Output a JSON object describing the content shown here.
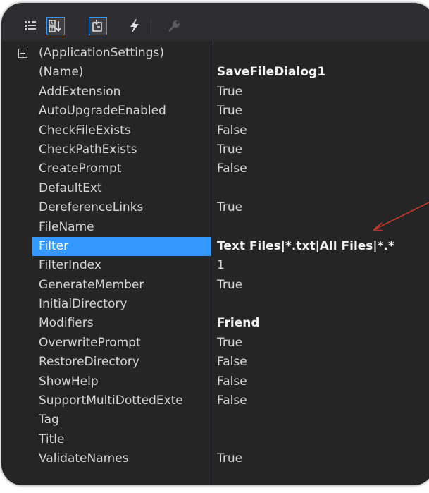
{
  "toolbar": {
    "buttons": [
      {
        "icon": "categorized-icon",
        "active": false
      },
      {
        "icon": "alphabetical-icon",
        "active": true
      },
      {
        "icon": "properties-icon",
        "active": true
      },
      {
        "icon": "events-icon",
        "active": false
      },
      {
        "icon": "property-pages-icon",
        "active": false
      }
    ]
  },
  "properties": [
    {
      "name": "(ApplicationSettings)",
      "value": "",
      "expandable": true
    },
    {
      "name": "(Name)",
      "value": "SaveFileDialog1",
      "bold": true
    },
    {
      "name": "AddExtension",
      "value": "True"
    },
    {
      "name": "AutoUpgradeEnabled",
      "value": "True"
    },
    {
      "name": "CheckFileExists",
      "value": "False"
    },
    {
      "name": "CheckPathExists",
      "value": "True"
    },
    {
      "name": "CreatePrompt",
      "value": "False"
    },
    {
      "name": "DefaultExt",
      "value": ""
    },
    {
      "name": "DereferenceLinks",
      "value": "True"
    },
    {
      "name": "FileName",
      "value": ""
    },
    {
      "name": "Filter",
      "value": "Text Files|*.txt|All Files|*.*",
      "bold": true,
      "selected": true
    },
    {
      "name": "FilterIndex",
      "value": "1"
    },
    {
      "name": "GenerateMember",
      "value": "True"
    },
    {
      "name": "InitialDirectory",
      "value": ""
    },
    {
      "name": "Modifiers",
      "value": "Friend",
      "bold": true
    },
    {
      "name": "OverwritePrompt",
      "value": "True"
    },
    {
      "name": "RestoreDirectory",
      "value": "False"
    },
    {
      "name": "ShowHelp",
      "value": "False"
    },
    {
      "name": "SupportMultiDottedExte",
      "value": "False"
    },
    {
      "name": "Tag",
      "value": ""
    },
    {
      "name": "Title",
      "value": ""
    },
    {
      "name": "ValidateNames",
      "value": "True"
    }
  ],
  "colors": {
    "background": "#252526",
    "selection": "#3399ff",
    "annotation_arrow": "#c0392b"
  }
}
